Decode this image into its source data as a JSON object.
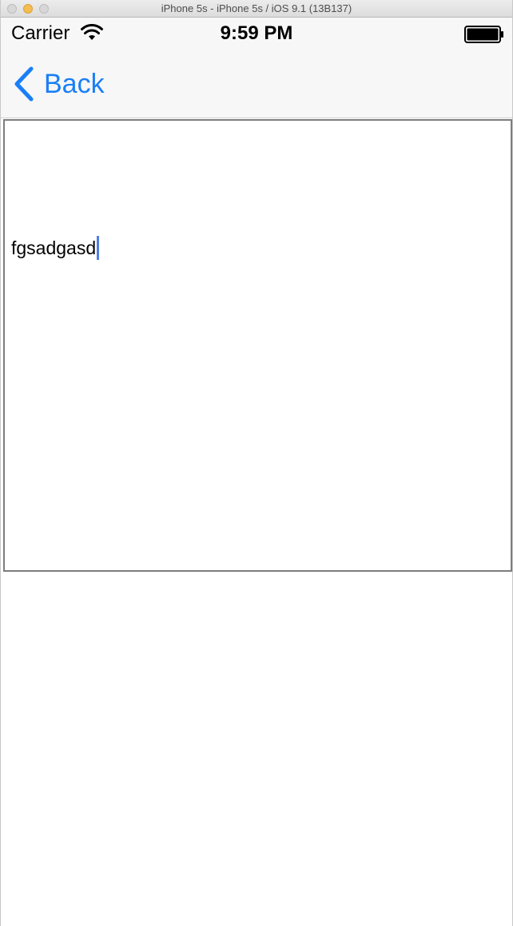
{
  "window": {
    "title": "iPhone 5s - iPhone 5s / iOS 9.1 (13B137)"
  },
  "status_bar": {
    "carrier": "Carrier",
    "time": "9:59 PM",
    "wifi_icon": "wifi-icon",
    "battery_icon": "battery-icon"
  },
  "nav_bar": {
    "back_label": "Back",
    "back_icon": "chevron-left-icon",
    "tint_color": "#1a7ff7"
  },
  "text_view": {
    "value": "fgsadgasd",
    "caret_color": "#4f7fe6"
  }
}
